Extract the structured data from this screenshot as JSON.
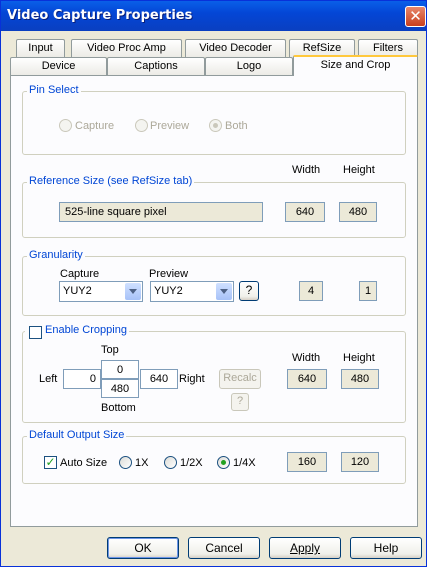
{
  "window": {
    "title": "Video Capture Properties",
    "close_glyph": "✕"
  },
  "tabs": {
    "row1": [
      "Input",
      "Video Proc Amp",
      "Video Decoder",
      "RefSize",
      "Filters"
    ],
    "row2": [
      "Device",
      "Captions",
      "Logo",
      "Size and Crop"
    ],
    "active": "Size and Crop"
  },
  "pin_select": {
    "label": "Pin Select",
    "options": [
      "Capture",
      "Preview",
      "Both"
    ],
    "selected": "Both"
  },
  "reference_size": {
    "label": "Reference Size  (see RefSize tab)",
    "width_header": "Width",
    "height_header": "Height",
    "format": "525-line square pixel",
    "width": "640",
    "height": "480"
  },
  "granularity": {
    "label": "Granularity",
    "capture_label": "Capture",
    "preview_label": "Preview",
    "capture_value": "YUY2",
    "preview_value": "YUY2",
    "help_label": "?",
    "width": "4",
    "height": "1"
  },
  "cropping": {
    "label": "Enable Cropping",
    "checked": false,
    "top_label": "Top",
    "bottom_label": "Bottom",
    "left_label": "Left",
    "right_label": "Right",
    "left": "0",
    "top": "0",
    "bottom": "480",
    "right": "640",
    "recalc_label": "Recalc",
    "help_label": "?",
    "width_header": "Width",
    "height_header": "Height",
    "width": "640",
    "height": "480"
  },
  "default_output": {
    "label": "Default Output Size",
    "auto_size_label": "Auto Size",
    "auto_size_checked": true,
    "check_glyph": "✓",
    "options": [
      "1X",
      "1/2X",
      "1/4X"
    ],
    "selected": "1/4X",
    "width": "160",
    "height": "120"
  },
  "buttons": {
    "ok": "OK",
    "cancel": "Cancel",
    "apply": "Apply",
    "help": "Help"
  }
}
